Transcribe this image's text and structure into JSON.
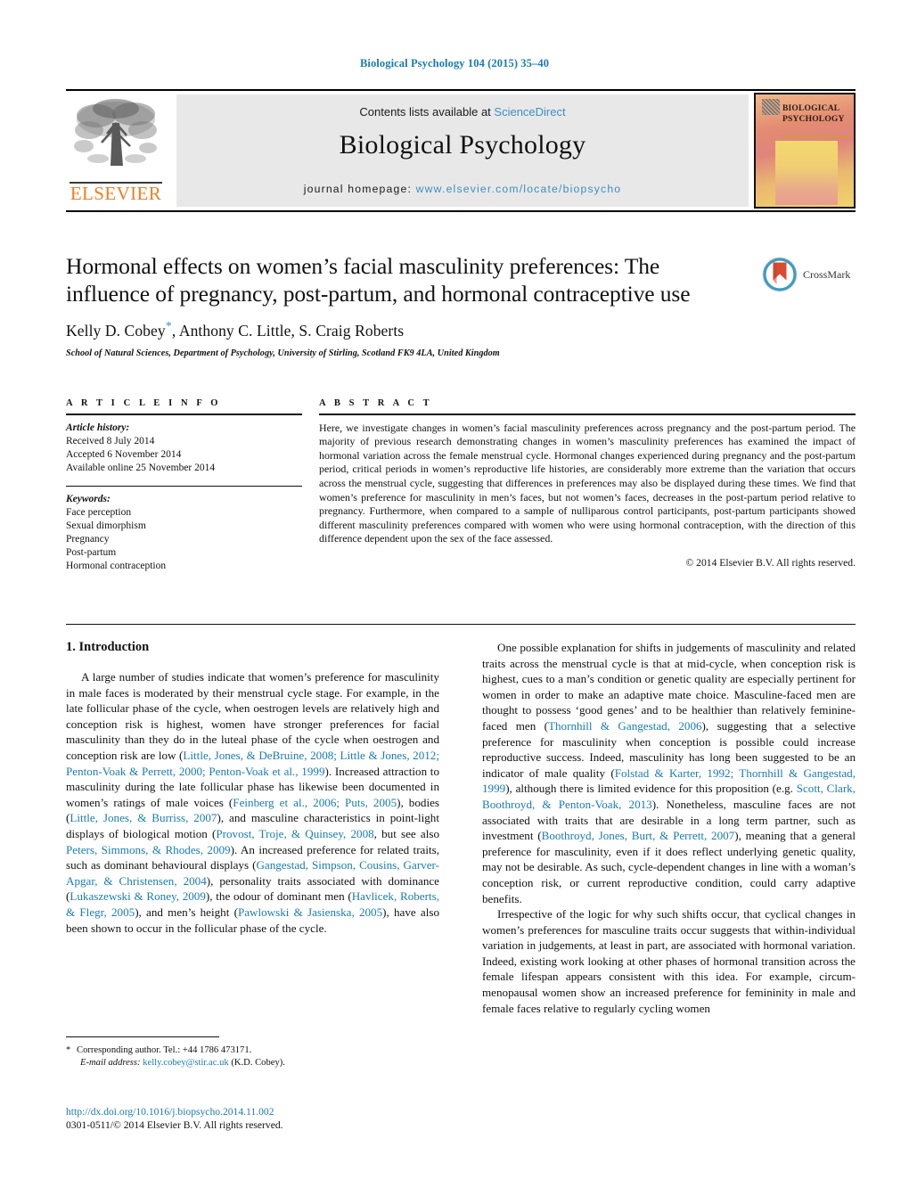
{
  "running_head": "Biological Psychology 104 (2015) 35–40",
  "masthead": {
    "contents_prefix": "Contents lists available at ",
    "contents_link": "ScienceDirect",
    "journal_name": "Biological Psychology",
    "homepage_prefix": "journal homepage: ",
    "homepage_url": "www.elsevier.com/locate/biopsycho",
    "publisher": "ELSEVIER",
    "cover_title_line1": "BIOLOGICAL",
    "cover_title_line2": "PSYCHOLOGY"
  },
  "article": {
    "title": "Hormonal effects on women’s facial masculinity preferences: The influence of pregnancy, post-partum, and hormonal contraceptive use",
    "authors": "Kelly D. Cobey",
    "authors_rest": ", Anthony C. Little, S. Craig Roberts",
    "corresponding_marker": "*",
    "affiliation": "School of Natural Sciences, Department of Psychology, University of Stirling, Scotland FK9 4LA, United Kingdom",
    "crossmark_label": "CrossMark"
  },
  "info": {
    "heading": "A R T I C L E   I N F O",
    "history_label": "Article history:",
    "history": [
      "Received 8 July 2014",
      "Accepted 6 November 2014",
      "Available online 25 November 2014"
    ],
    "keywords_label": "Keywords:",
    "keywords": [
      "Face perception",
      "Sexual dimorphism",
      "Pregnancy",
      "Post-partum",
      "Hormonal contraception"
    ]
  },
  "abstract": {
    "heading": "A B S T R A C T",
    "text": "Here, we investigate changes in women’s facial masculinity preferences across pregnancy and the post-partum period. The majority of previous research demonstrating changes in women’s masculinity preferences has examined the impact of hormonal variation across the female menstrual cycle. Hormonal changes experienced during pregnancy and the post-partum period, critical periods in women’s reproductive life histories, are considerably more extreme than the variation that occurs across the menstrual cycle, suggesting that differences in preferences may also be displayed during these times. We find that women’s preference for masculinity in men’s faces, but not women’s faces, decreases in the post-partum period relative to pregnancy. Furthermore, when compared to a sample of nulliparous control participants, post-partum participants showed different masculinity preferences compared with women who were using hormonal contraception, with the direction of this difference dependent upon the sex of the face assessed.",
    "copyright": "© 2014 Elsevier B.V. All rights reserved."
  },
  "body": {
    "section_heading": "1.  Introduction",
    "left_paragraphs": [
      {
        "segments": [
          {
            "t": "A large number of studies indicate that women’s preference for masculinity in male faces is moderated by their menstrual cycle stage. For example, in the late follicular phase of the cycle, when oestrogen levels are relatively high and conception risk is highest, women have stronger preferences for facial masculinity than they do in the luteal phase of the cycle when oestrogen and conception risk are low (",
            "ref": false
          },
          {
            "t": "Little, Jones, & DeBruine, 2008; Little & Jones, 2012; Penton-Voak & Perrett, 2000; Penton-Voak et al., 1999",
            "ref": true
          },
          {
            "t": "). Increased attraction to masculinity during the late follicular phase has likewise been documented in women’s ratings of male voices (",
            "ref": false
          },
          {
            "t": "Feinberg et al., 2006; Puts, 2005",
            "ref": true
          },
          {
            "t": "), bodies (",
            "ref": false
          },
          {
            "t": "Little, Jones, & Burriss, 2007",
            "ref": true
          },
          {
            "t": "), and masculine characteristics in point-light displays of biological motion (",
            "ref": false
          },
          {
            "t": "Provost, Troje, & Quinsey, 2008",
            "ref": true
          },
          {
            "t": ", but see also ",
            "ref": false
          },
          {
            "t": "Peters, Simmons, & Rhodes, 2009",
            "ref": true
          },
          {
            "t": "). An increased preference for related traits, such as dominant behavioural displays (",
            "ref": false
          },
          {
            "t": "Gangestad, Simpson, Cousins, Garver-Apgar, & Christensen, 2004",
            "ref": true
          },
          {
            "t": "), personality traits associated with dominance (",
            "ref": false
          },
          {
            "t": "Lukaszewski & Roney, 2009",
            "ref": true
          },
          {
            "t": "), the odour of dominant men (",
            "ref": false
          },
          {
            "t": "Havlicek, Roberts, & Flegr, 2005",
            "ref": true
          },
          {
            "t": "), and men’s height (",
            "ref": false
          },
          {
            "t": "Pawlowski & Jasienska, 2005",
            "ref": true
          },
          {
            "t": "), have also been shown to occur in the follicular phase of the cycle.",
            "ref": false
          }
        ]
      }
    ],
    "right_paragraphs": [
      {
        "segments": [
          {
            "t": "One possible explanation for shifts in judgements of masculinity and related traits across the menstrual cycle is that at mid-cycle, when conception risk is highest, cues to a man’s condition or genetic quality are especially pertinent for women in order to make an adaptive mate choice. Masculine-faced men are thought to possess ‘good genes’ and to be healthier than relatively feminine-faced men (",
            "ref": false
          },
          {
            "t": "Thornhill & Gangestad, 2006",
            "ref": true
          },
          {
            "t": "), suggesting that a selective preference for masculinity when conception is possible could increase reproductive success. Indeed, masculinity has long been suggested to be an indicator of male quality (",
            "ref": false
          },
          {
            "t": "Folstad & Karter, 1992; Thornhill & Gangestad, 1999",
            "ref": true
          },
          {
            "t": "), although there is limited evidence for this proposition (e.g. ",
            "ref": false
          },
          {
            "t": "Scott, Clark, Boothroyd, & Penton-Voak, 2013",
            "ref": true
          },
          {
            "t": "). Nonetheless, masculine faces are not associated with traits that are desirable in a long term partner, such as investment (",
            "ref": false
          },
          {
            "t": "Boothroyd, Jones, Burt, & Perrett, 2007",
            "ref": true
          },
          {
            "t": "), meaning that a general preference for masculinity, even if it does reflect underlying genetic quality, may not be desirable. As such, cycle-dependent changes in line with a woman’s conception risk, or current reproductive condition, could carry adaptive benefits.",
            "ref": false
          }
        ]
      },
      {
        "segments": [
          {
            "t": "Irrespective of the logic for why such shifts occur, that cyclical changes in women’s preferences for masculine traits occur suggests that within-individual variation in judgements, at least in part, are associated with hormonal variation. Indeed, existing work looking at other phases of hormonal transition across the female lifespan appears consistent with this idea. For example, circum-menopausal women show an increased preference for femininity in male and female faces relative to regularly cycling women",
            "ref": false
          }
        ]
      }
    ]
  },
  "footnote": {
    "marker": "*",
    "corresponding": "Corresponding author. Tel.: +44 1786 473171.",
    "email_label": "E-mail address:",
    "email": "kelly.cobey@stir.ac.uk",
    "email_suffix": "(K.D. Cobey)."
  },
  "footer": {
    "doi": "http://dx.doi.org/10.1016/j.biopsycho.2014.11.002",
    "issn": "0301-0511/© 2014 Elsevier B.V. All rights reserved."
  },
  "colors": {
    "link": "#1a7bb0",
    "elsevier_orange": "#f07d20",
    "panel_gray": "#e8e8e8"
  }
}
